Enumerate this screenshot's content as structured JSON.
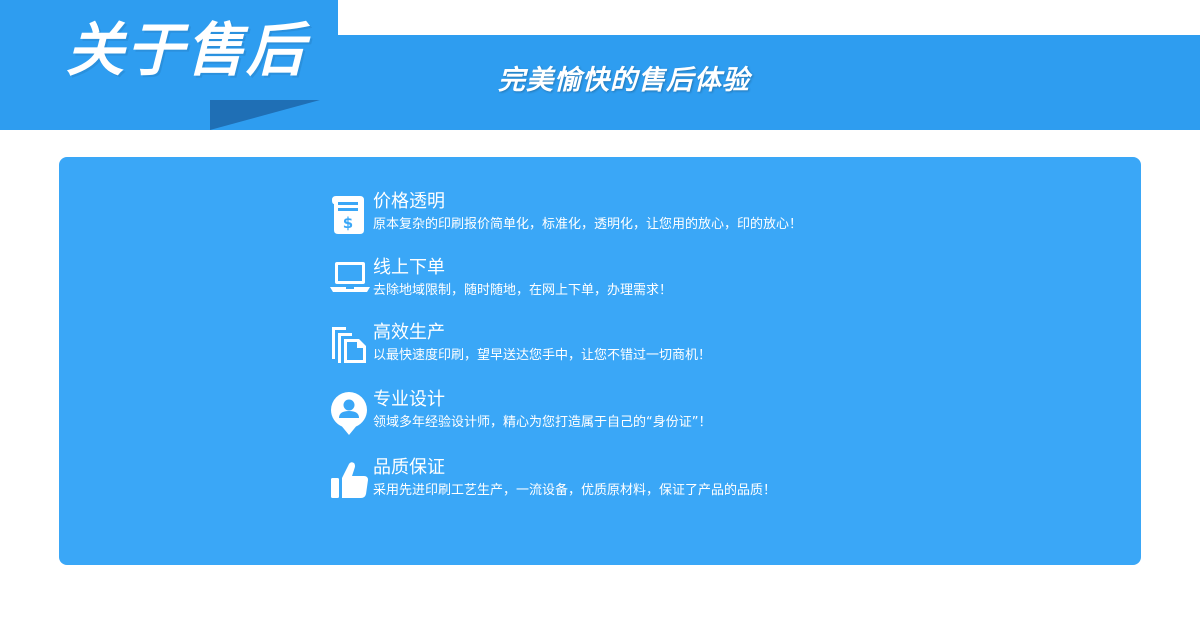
{
  "header": {
    "title": "关于售后",
    "subtitle": "完美愉快的售后体验"
  },
  "colors": {
    "banner": "#2e9df0",
    "banner_dark": "#1f6fb5",
    "panel": "#3aa7f7",
    "text": "#ffffff"
  },
  "features": [
    {
      "icon": "receipt-dollar-icon",
      "title": "价格透明",
      "desc": "原本复杂的印刷报价简单化，标准化，透明化，让您用的放心，印的放心！"
    },
    {
      "icon": "laptop-icon",
      "title": "线上下单",
      "desc": "去除地域限制，随时随地，在网上下单，办理需求！"
    },
    {
      "icon": "stacked-documents-icon",
      "title": "高效生产",
      "desc": "以最快速度印刷，望早送达您手中，让您不错过一切商机！"
    },
    {
      "icon": "user-pin-icon",
      "title": "专业设计",
      "desc": "领域多年经验设计师，精心为您打造属于自己的“身份证”！"
    },
    {
      "icon": "thumbs-up-icon",
      "title": "品质保证",
      "desc": "采用先进印刷工艺生产，一流设备，优质原材料，保证了产品的品质！"
    }
  ]
}
